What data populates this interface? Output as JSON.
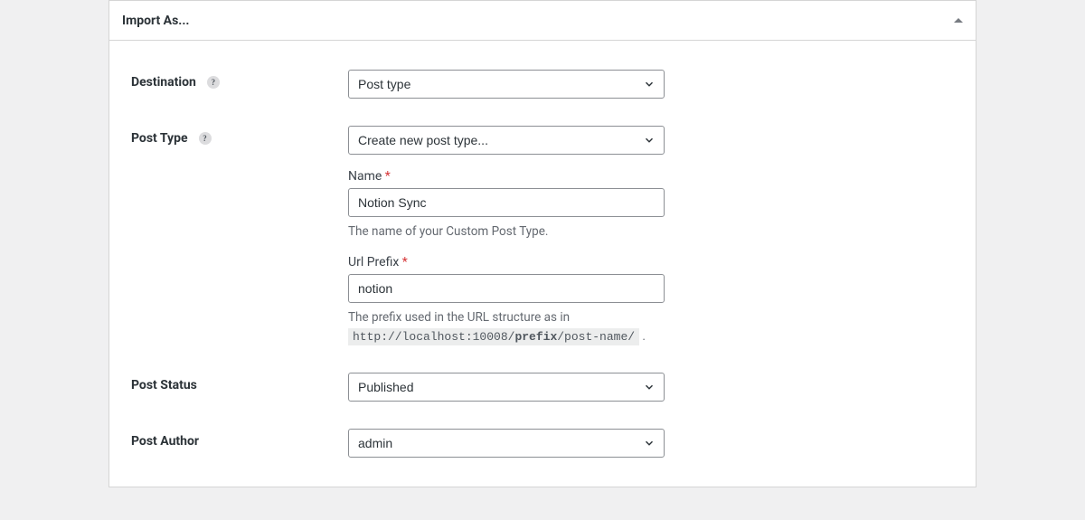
{
  "panel": {
    "title": "Import As..."
  },
  "fields": {
    "destination": {
      "label": "Destination",
      "value": "Post type"
    },
    "postType": {
      "label": "Post Type",
      "value": "Create new post type...",
      "name": {
        "label": "Name",
        "value": "Notion Sync",
        "description": "The name of your Custom Post Type."
      },
      "urlPrefix": {
        "label": "Url Prefix",
        "value": "notion",
        "descriptionPrefix": "The prefix used in the URL structure as in ",
        "urlPre": "http://localhost:10008/",
        "urlBold": "prefix",
        "urlPost": "/post-name/"
      }
    },
    "postStatus": {
      "label": "Post Status",
      "value": "Published"
    },
    "postAuthor": {
      "label": "Post Author",
      "value": "admin"
    }
  }
}
